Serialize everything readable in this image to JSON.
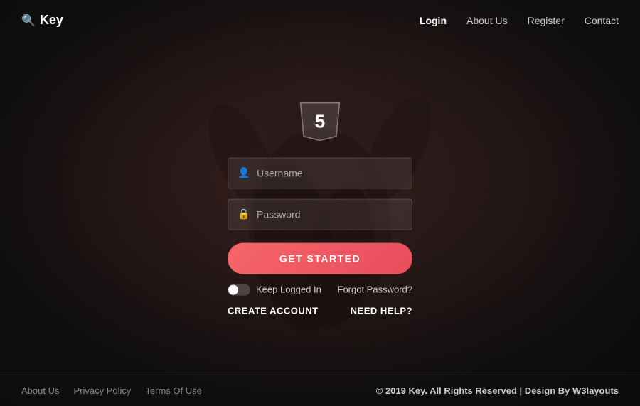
{
  "brand": {
    "logo_text": "Key",
    "logo_icon": "🔍"
  },
  "nav": {
    "items": [
      {
        "label": "Login",
        "active": true
      },
      {
        "label": "About Us",
        "active": false
      },
      {
        "label": "Register",
        "active": false
      },
      {
        "label": "Contact",
        "active": false
      }
    ]
  },
  "hero_badge": "5",
  "form": {
    "username_placeholder": "Username",
    "password_placeholder": "Password",
    "submit_label": "GET STARTED",
    "keep_logged_label": "Keep Logged In",
    "forgot_password_label": "Forgot Password?",
    "create_account_label": "CREATE ACCOUNT",
    "need_help_label": "NEED HELP?"
  },
  "footer": {
    "links": [
      {
        "label": "About Us"
      },
      {
        "label": "Privacy Policy"
      },
      {
        "label": "Terms Of Use"
      }
    ],
    "copyright": "© 2019 Key. All Rights Reserved | Design By ",
    "designer": "W3layouts"
  }
}
